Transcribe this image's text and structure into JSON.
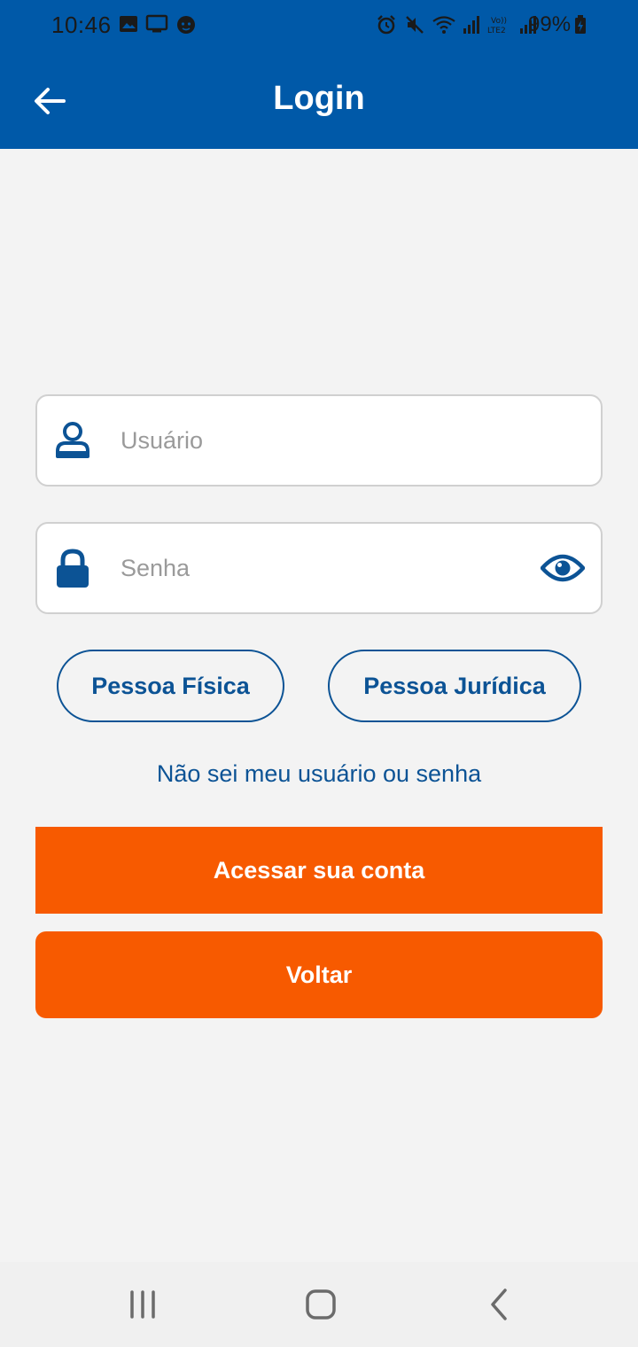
{
  "status_bar": {
    "time": "10:46",
    "battery": "99%",
    "icons_left": [
      "gallery-icon",
      "cast-icon",
      "face-icon"
    ],
    "icons_right": [
      "alarm-icon",
      "mute-icon",
      "wifi-icon",
      "signal-icon",
      "volte-lte2-icon",
      "signal-icon",
      "battery-charging-icon"
    ]
  },
  "app_bar": {
    "title": "Login",
    "back_icon": "arrow-left-icon"
  },
  "form": {
    "username_placeholder": "Usuário",
    "username_value": "",
    "password_placeholder": "Senha",
    "password_value": "",
    "user_icon": "user-icon",
    "lock_icon": "lock-icon",
    "show_password_icon": "eye-icon"
  },
  "person_type": {
    "physical_label": "Pessoa Física",
    "legal_label": "Pessoa Jurídica"
  },
  "forgot_link": "Não sei meu usuário ou senha",
  "actions": {
    "login_label": "Acessar sua conta",
    "back_label": "Voltar"
  },
  "colors": {
    "primary": "#0059a8",
    "accent": "#f75a00",
    "link": "#0c5395",
    "background": "#f3f3f3"
  },
  "nav_bar": {
    "icons": [
      "recents-icon",
      "home-icon",
      "back-icon"
    ]
  }
}
